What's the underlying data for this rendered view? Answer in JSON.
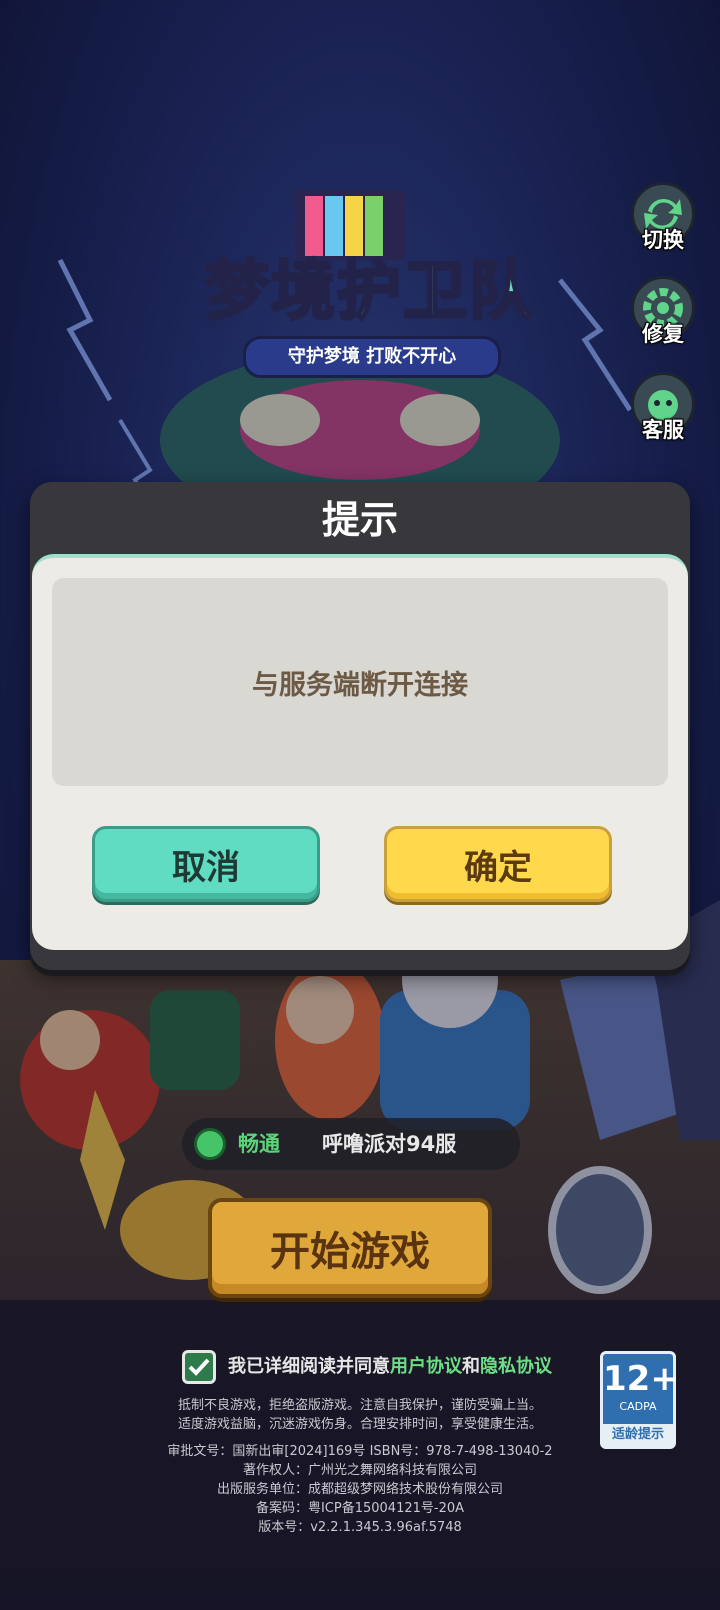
{
  "logo": {
    "title": "梦境护卫队",
    "slogan": "守护梦境  打败不开心"
  },
  "side_buttons": [
    {
      "label": "切换",
      "icon": "swap-arrows-icon"
    },
    {
      "label": "修复",
      "icon": "gear-repair-icon"
    },
    {
      "label": "客服",
      "icon": "customer-service-icon"
    }
  ],
  "dialog": {
    "title": "提示",
    "message": "与服务端断开连接",
    "cancel_label": "取消",
    "confirm_label": "确定"
  },
  "server": {
    "status": "畅通",
    "name": "呼噜派对94服"
  },
  "start_label": "开始游戏",
  "agreement": {
    "prefix": "我已详细阅读并同意",
    "user_agreement": "用户协议",
    "and": "和",
    "privacy_agreement": "隐私协议",
    "checked": true
  },
  "age_rating": {
    "age": "12+",
    "org": "CADPA",
    "tip": "适龄提示"
  },
  "footer": {
    "notice_line1": "抵制不良游戏，拒绝盗版游戏。注意自我保护，谨防受骗上当。",
    "notice_line2": "适度游戏益脑，沉迷游戏伤身。合理安排时间，享受健康生活。",
    "approval": "审批文号：国新出审[2024]169号 ISBN号：978-7-498-13040-2",
    "copyright": "著作权人：广州光之舞网络科技有限公司",
    "publisher": "出版服务单位：成都超级梦网络技术股份有限公司",
    "icp": "备案码：粤ICP备15004121号-20A",
    "version": "版本号：v2.2.1.345.3.96af.5748"
  },
  "colors": {
    "accent_green": "#5fdcc2",
    "accent_yellow": "#ffd84c",
    "link_green": "#6cdf86",
    "start_gold": "#e0a83a"
  }
}
